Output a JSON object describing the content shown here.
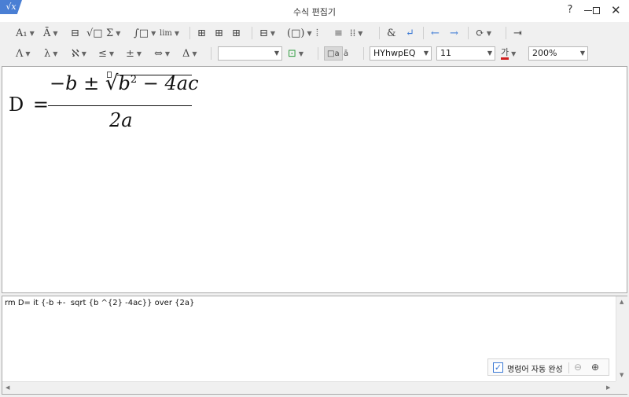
{
  "window": {
    "title": "수식 편집기",
    "app_icon": "√x",
    "help": "?",
    "close": "✕"
  },
  "toolbar1": [
    {
      "name": "format-text-button",
      "label": "A₁",
      "caret": true
    },
    {
      "name": "decoration-button",
      "label": "Ā",
      "caret": true
    },
    {
      "name": "fraction-button",
      "label": "⊟",
      "caret": false
    },
    {
      "name": "root-button",
      "label": "√□",
      "caret": false
    },
    {
      "name": "sum-button",
      "label": "Σ",
      "caret": true
    },
    {
      "name": "integral-button",
      "label": "∫□",
      "caret": true
    },
    {
      "name": "limit-button",
      "label": "lim",
      "caret": true
    },
    {
      "name": "matrix-left-button",
      "label": "⊞",
      "caret": false
    },
    {
      "name": "matrix-center-button",
      "label": "⊞",
      "caret": false
    },
    {
      "name": "matrix-right-button",
      "label": "⊞",
      "caret": false
    },
    {
      "name": "align-button",
      "label": "⊟",
      "caret": true
    },
    {
      "name": "bracket-button",
      "label": "(□)",
      "caret": true
    },
    {
      "name": "array-button",
      "label": "⦙",
      "caret": false
    },
    {
      "name": "row-button",
      "label": "≡",
      "caret": false
    },
    {
      "name": "grid-button",
      "label": "⁞⁞",
      "caret": true
    },
    {
      "name": "ampersand-button",
      "label": "&",
      "caret": false
    },
    {
      "name": "newline-button",
      "label": "↵",
      "caret": false
    },
    {
      "name": "undo-button",
      "label": "←",
      "caret": false
    },
    {
      "name": "redo-button",
      "label": "→",
      "caret": false
    },
    {
      "name": "render-button",
      "label": "⟳",
      "caret": true
    },
    {
      "name": "insert-button",
      "label": "⇥",
      "caret": false
    }
  ],
  "toolbar2": [
    {
      "name": "italic-greek-button",
      "label": "Λ",
      "caret": true
    },
    {
      "name": "lambda-button",
      "label": "λ",
      "caret": true
    },
    {
      "name": "aleph-button",
      "label": "ℵ",
      "caret": true
    },
    {
      "name": "relation-button",
      "label": "≤",
      "caret": true
    },
    {
      "name": "plusminus-button",
      "label": "±",
      "caret": true
    },
    {
      "name": "arrow-button",
      "label": "⇔",
      "caret": true
    },
    {
      "name": "delta-button",
      "label": "Δ",
      "caret": true
    }
  ],
  "combos": {
    "style": "",
    "font": "HYhwpEQ",
    "size": "11",
    "zoom": "200%"
  },
  "editor": {
    "lhs": "D",
    "equals": "=",
    "numerator": "−b ± ∛b² − 4ac",
    "numerator_parts": {
      "minus_b": "−b",
      "pm": "±",
      "root_sym": "√",
      "b": "b",
      "exp": "2",
      "minus": "−",
      "four_ac": "4ac"
    },
    "denominator": "2a"
  },
  "command": {
    "text": "rm D= it {-b +-  sqrt {b ^{2} -4ac}} over {2a}"
  },
  "autocomplete": {
    "checked": true,
    "label": "명령어 자동 완성"
  }
}
